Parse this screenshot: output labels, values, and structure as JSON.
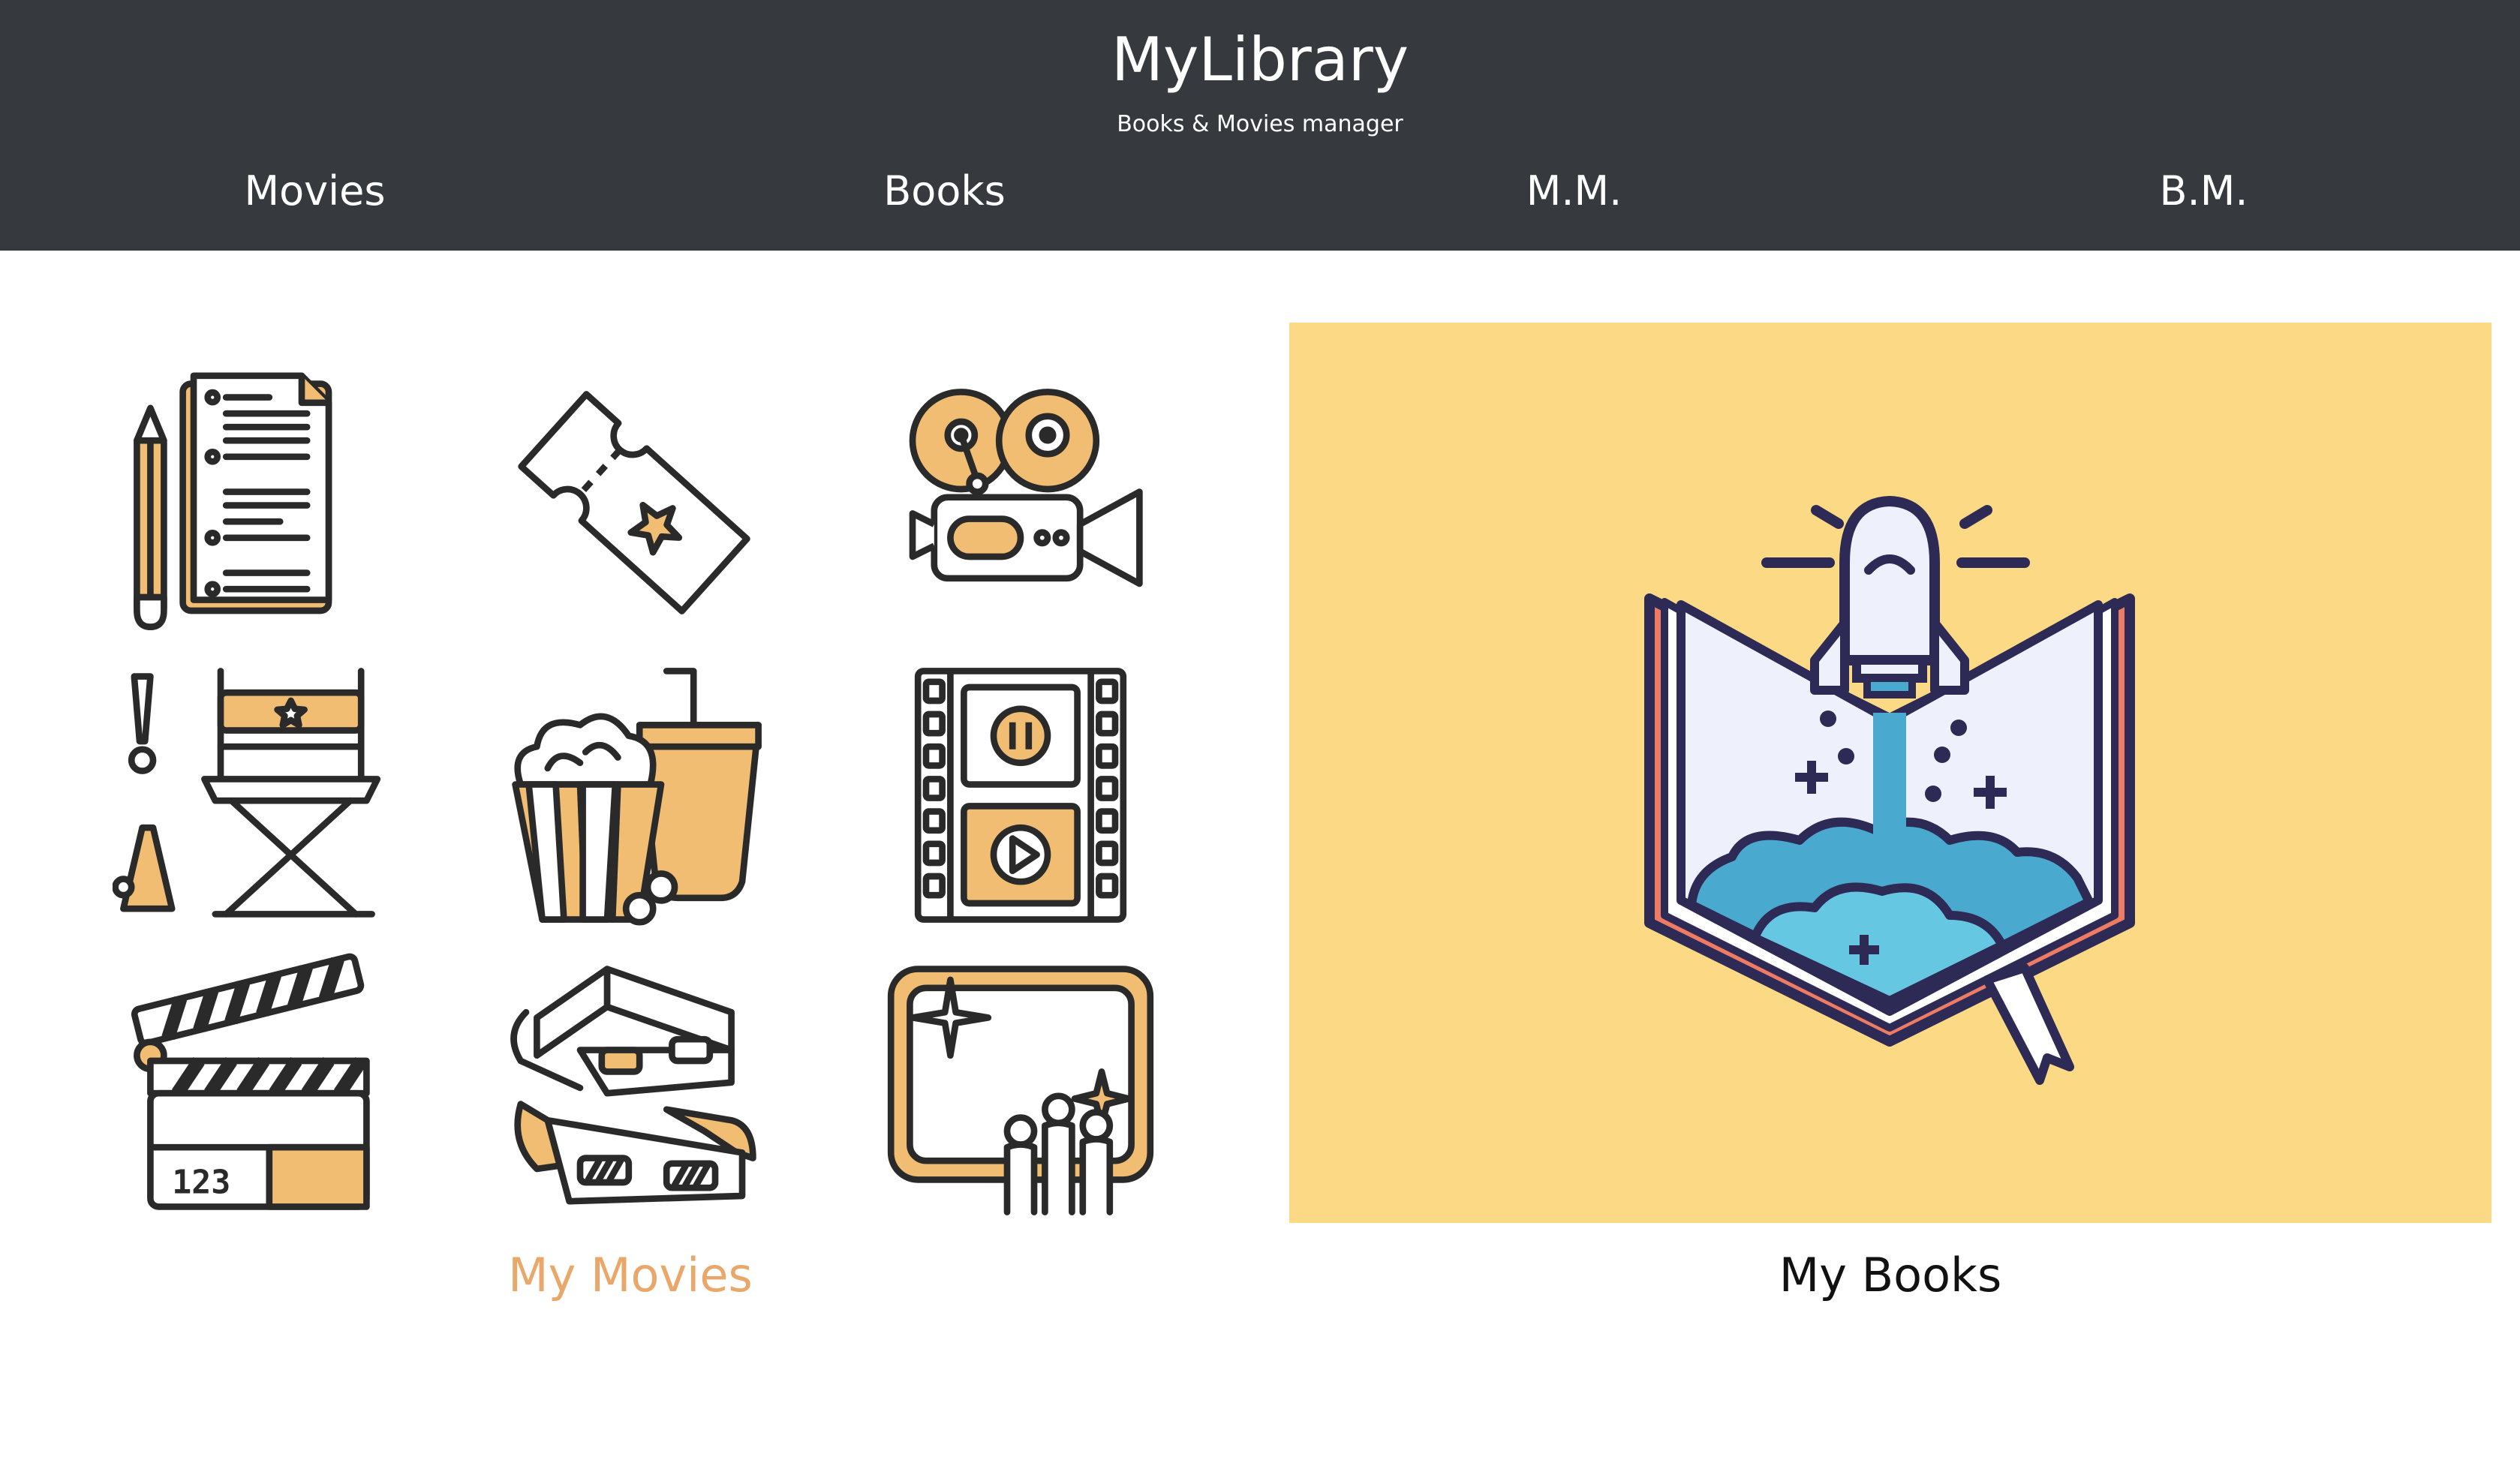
{
  "header": {
    "title": "MyLibrary",
    "subtitle": "Books & Movies manager"
  },
  "nav": {
    "items": [
      {
        "label": "Movies"
      },
      {
        "label": "Books"
      },
      {
        "label": "M.M."
      },
      {
        "label": "B.M."
      }
    ]
  },
  "movies_card": {
    "label": "My Movies",
    "label_color": "#e9a86a",
    "icons": [
      "script-and-pencil-icon",
      "ticket-icon",
      "movie-camera-icon",
      "director-chair-icon",
      "popcorn-and-drink-icon",
      "film-strip-icon",
      "clapperboard-icon",
      "3d-glasses-icon",
      "cinema-screen-audience-icon"
    ]
  },
  "books_card": {
    "label": "My Books",
    "background": "#fbd985",
    "icon": "book-rocket-icon"
  },
  "colors": {
    "header_bg": "#363a3e",
    "accent": "#f0bd72",
    "outline": "#2a2a2a"
  }
}
